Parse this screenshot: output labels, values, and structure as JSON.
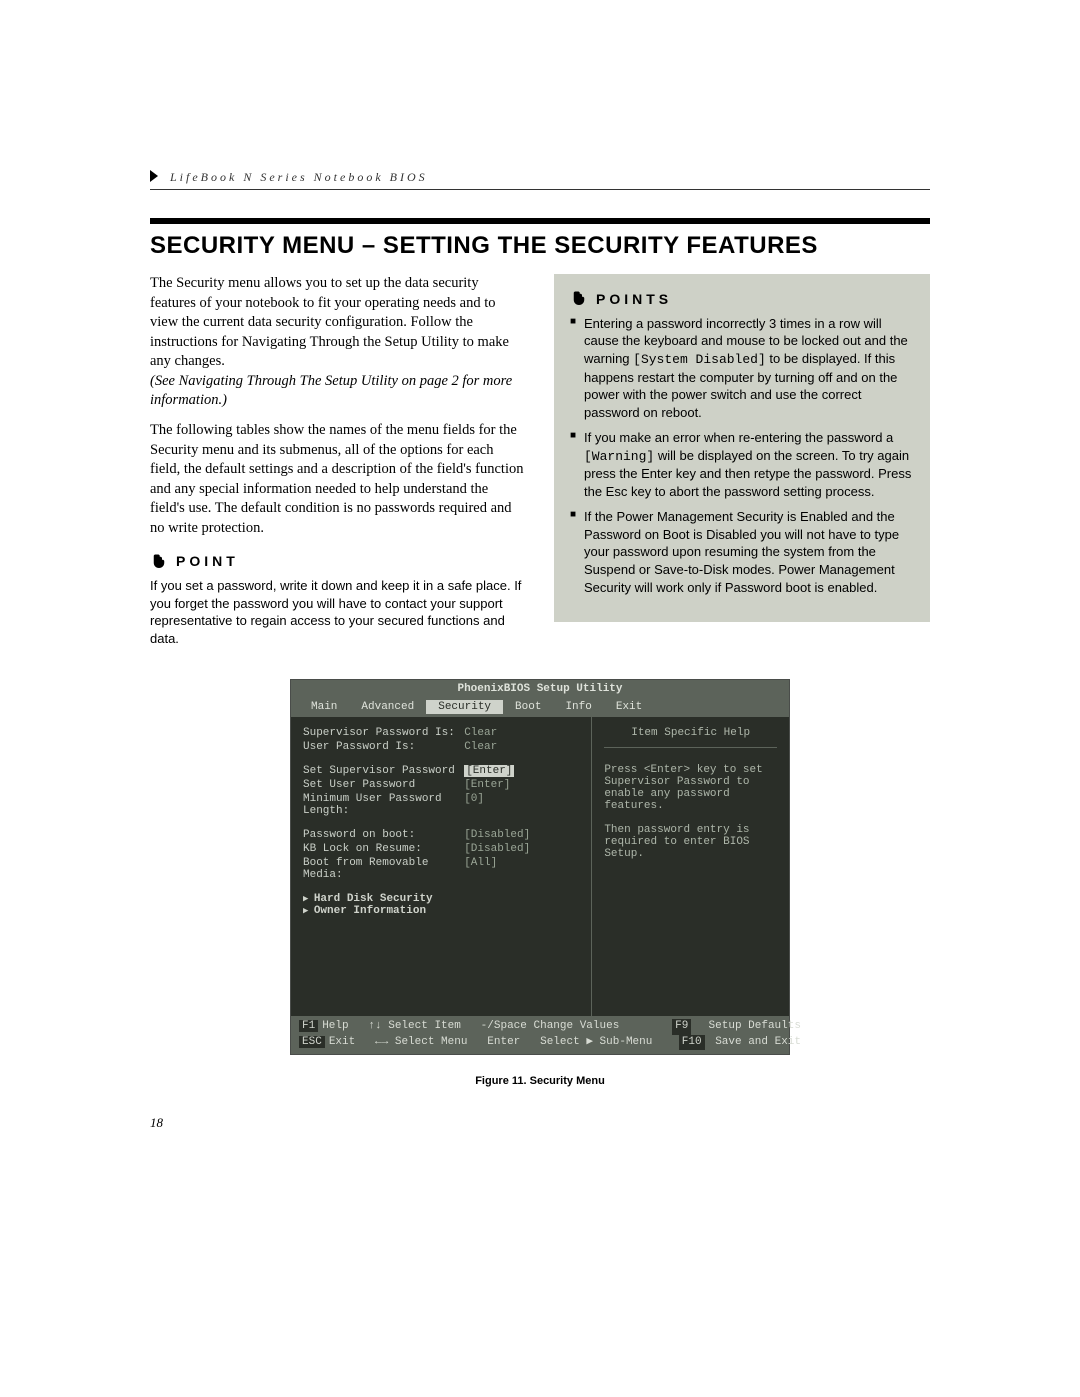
{
  "header": {
    "running": "LifeBook N Series Notebook BIOS"
  },
  "title": "SECURITY MENU – SETTING THE SECURITY FEATURES",
  "intro": {
    "p1": "The Security menu allows you to set up the data security features of your notebook to fit your operating needs and to view the current data security configuration. Follow the instructions for Navigating Through the Setup Utility to make any changes.",
    "p1_ref": "(See Navigating Through The Setup Utility on page 2 for more information.)",
    "p2": "The following tables show the names of the menu fields for the Security menu and its submenus, all of the options for each field, the default settings and a description of the field's function and any special information needed to help understand the field's use. The default condition is no passwords required and no write protection."
  },
  "point_left": {
    "label": "POINT",
    "body": "If you set a password, write it down and keep it in a safe place. If you forget the password you will have to contact your support representative to regain access to your secured functions and data."
  },
  "points_right": {
    "label": "POINTS",
    "items": [
      {
        "pre": "Entering a password incorrectly 3 times in a row will cause the keyboard and mouse to be locked out and the warning ",
        "code": "[System Disabled]",
        "post": " to be displayed. If this happens restart the computer by turning off and on the power with the power switch and use the correct password on reboot."
      },
      {
        "pre": "If you make an error when re-entering the password a ",
        "code": "[Warning]",
        "post": " will be displayed on the screen. To try again press the Enter key and then retype the password. Press the Esc key to abort the password setting process."
      },
      {
        "pre": "If the Power Management Security is Enabled and the Password on Boot is Disabled you will not have to type your password upon resuming the system from the Suspend or Save-to-Disk modes. Power Management Security will work only if Password boot is enabled.",
        "code": "",
        "post": ""
      }
    ]
  },
  "bios": {
    "title": "PhoenixBIOS Setup Utility",
    "menus": [
      "Main",
      "Advanced",
      "Security",
      "Boot",
      "Info",
      "Exit"
    ],
    "active_menu": "Security",
    "help_title": "Item Specific Help",
    "help_body": "Press <Enter> key to set Supervisor Password to enable any password features.\n\nThen password entry is required to enter BIOS Setup.",
    "rows": [
      {
        "label": "Supervisor Password Is:",
        "value": "Clear",
        "sel": false
      },
      {
        "label": "User Password Is:",
        "value": "Clear",
        "sel": false
      },
      {
        "label": "",
        "value": "",
        "sel": false
      },
      {
        "label": "Set Supervisor Password",
        "value": "[Enter]",
        "sel": true
      },
      {
        "label": "Set User Password",
        "value": "[Enter]",
        "sel": false
      },
      {
        "label": "Minimum User Password Length:",
        "value": "[0]",
        "sel": false
      },
      {
        "label": "",
        "value": "",
        "sel": false
      },
      {
        "label": "Password on boot:",
        "value": "[Disabled]",
        "sel": false
      },
      {
        "label": "KB Lock on Resume:",
        "value": "[Disabled]",
        "sel": false
      },
      {
        "label": "Boot from Removable Media:",
        "value": "[All]",
        "sel": false
      }
    ],
    "subs": [
      "Hard Disk Security",
      "Owner Information"
    ],
    "footer": {
      "f1": "F1",
      "help": "Help",
      "arrows_v": "↑↓",
      "select_item": "Select Item",
      "minus_space": "-/Space",
      "change_values": "Change Values",
      "f9": "F9",
      "setup_defaults": "Setup Defaults",
      "esc": "ESC",
      "exit": "Exit",
      "arrows_h": "←→",
      "select_menu": "Select Menu",
      "enter": "Enter",
      "select_sub": "Select ▶ Sub-Menu",
      "f10": "F10",
      "save_exit": "Save and Exit"
    }
  },
  "figure_caption": "Figure 11.  Security Menu",
  "page_number": "18"
}
